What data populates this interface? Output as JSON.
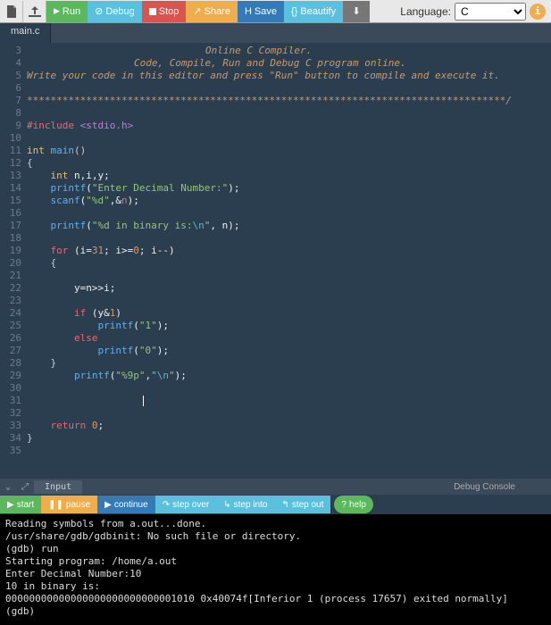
{
  "toolbar": {
    "run": "Run",
    "debug": "Debug",
    "stop": "Stop",
    "share": "Share",
    "save": "Save",
    "beautify": "Beautify",
    "language_label": "Language:",
    "language_value": "C"
  },
  "tab": {
    "name": "main.c"
  },
  "editor": {
    "first_line": 3,
    "lines": [
      {
        "n": 3,
        "cls": "comment",
        "indent": 200,
        "text": "Online C Compiler."
      },
      {
        "n": 4,
        "cls": "comment",
        "indent": 120,
        "text": "Code, Compile, Run and Debug C program online."
      },
      {
        "n": 5,
        "cls": "comment",
        "indent": 0,
        "text": "Write your code in this editor and press \"Run\" button to compile and execute it."
      },
      {
        "n": 6,
        "cls": "",
        "text": ""
      },
      {
        "n": 7,
        "cls": "comment",
        "text": "*********************************************************************************/"
      },
      {
        "n": 8,
        "cls": "",
        "text": ""
      },
      {
        "n": 9,
        "html": "<span class='keyword'>#include</span> <span class='include'>&lt;stdio.h&gt;</span>"
      },
      {
        "n": 10,
        "cls": "",
        "text": ""
      },
      {
        "n": 11,
        "html": "<span class='type'>int</span> <span class='func'>main</span><span class='punct'>()</span>"
      },
      {
        "n": 12,
        "html": "<span class='punct'>{</span>"
      },
      {
        "n": 13,
        "html": "    <span class='type'>int</span> n,i,y;"
      },
      {
        "n": 14,
        "html": "    <span class='func'>printf</span>(<span class='string'>\"Enter Decimal Number:\"</span>);"
      },
      {
        "n": 15,
        "html": "    <span class='func'>scanf</span>(<span class='string'>\"%d\"</span>,&amp;<span class='keyword'>n</span>);"
      },
      {
        "n": 16,
        "cls": "",
        "text": ""
      },
      {
        "n": 17,
        "html": "    <span class='func'>printf</span>(<span class='string'>\"%d in binary is:</span><span class='escape'>\\n</span><span class='string'>\"</span>, n);"
      },
      {
        "n": 18,
        "cls": "",
        "text": ""
      },
      {
        "n": 19,
        "html": "    <span class='keyword'>for</span> (i=<span class='number'>31</span>; i&gt;=<span class='number'>0</span>; i--)"
      },
      {
        "n": 20,
        "html": "    <span class='punct'>{</span>"
      },
      {
        "n": 21,
        "cls": "",
        "text": ""
      },
      {
        "n": 22,
        "html": "        y=n&gt;&gt;i;"
      },
      {
        "n": 23,
        "cls": "",
        "text": ""
      },
      {
        "n": 24,
        "html": "        <span class='keyword'>if</span> (y&amp;<span class='number'>1</span>)"
      },
      {
        "n": 25,
        "html": "            <span class='func'>printf</span>(<span class='string'>\"1\"</span>);"
      },
      {
        "n": 26,
        "html": "        <span class='keyword'>else</span>"
      },
      {
        "n": 27,
        "html": "            <span class='func'>printf</span>(<span class='string'>\"0\"</span>);"
      },
      {
        "n": 28,
        "html": "    <span class='punct'>}</span>"
      },
      {
        "n": 29,
        "html": "        <span class='func'>printf</span>(<span class='string'>\"%9p\"</span>,<span class='string'>\"</span><span class='escape'>\\n</span><span class='string'>\"</span>);"
      },
      {
        "n": 30,
        "cls": "",
        "text": ""
      },
      {
        "n": 31,
        "cursor": true,
        "text": ""
      },
      {
        "n": 32,
        "cls": "",
        "text": ""
      },
      {
        "n": 33,
        "html": "    <span class='keyword'>return</span> <span class='number'>0</span>;"
      },
      {
        "n": 34,
        "html": "<span class='punct'>}</span>"
      },
      {
        "n": 35,
        "cls": "",
        "text": ""
      }
    ]
  },
  "panel": {
    "input_label": "Input",
    "debug_label": "Debug Console"
  },
  "debug": {
    "start": "start",
    "pause": "pause",
    "continue": "continue",
    "step_over": "step over",
    "step_into": "step into",
    "step_out": "step out",
    "help": "help"
  },
  "console": {
    "lines": [
      "Reading symbols from a.out...done.",
      "/usr/share/gdb/gdbinit: No such file or directory.",
      "(gdb) run",
      "Starting program: /home/a.out",
      "Enter Decimal Number:10",
      "10 in binary is:",
      "00000000000000000000000000001010 0x40074f[Inferior 1 (process 17657) exited normally]",
      "(gdb)"
    ]
  }
}
